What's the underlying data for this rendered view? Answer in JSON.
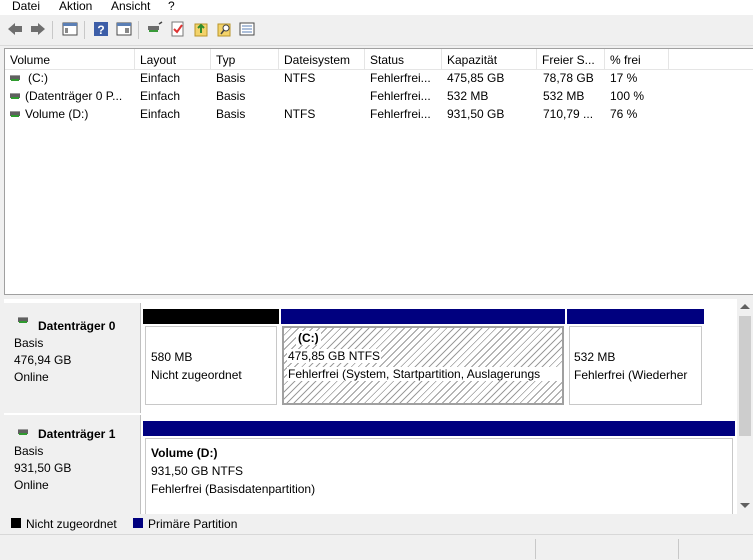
{
  "menu": [
    "Datei",
    "Aktion",
    "Ansicht",
    "?"
  ],
  "toolbar": {
    "buttons": [
      "back-icon",
      "forward-icon",
      "console-tree-icon",
      "help-icon",
      "properties-pane-icon",
      "connect-icon",
      "check-icon",
      "export-icon",
      "search-icon",
      "list-icon"
    ]
  },
  "volume_table": {
    "columns": [
      "Volume",
      "Layout",
      "Typ",
      "Dateisystem",
      "Status",
      "Kapazität",
      "Freier S...",
      "% frei"
    ],
    "rows": [
      {
        "volume": "(C:)",
        "layout": "Einfach",
        "typ": "Basis",
        "dateisystem": "NTFS",
        "status": "Fehlerfrei...",
        "kapazitaet": "475,85 GB",
        "frei": "78,78 GB",
        "prozent": "17 %"
      },
      {
        "volume": "(Datenträger 0 P...",
        "layout": "Einfach",
        "typ": "Basis",
        "dateisystem": "",
        "status": "Fehlerfrei...",
        "kapazitaet": "532 MB",
        "frei": "532 MB",
        "prozent": "100 %"
      },
      {
        "volume": "Volume (D:)",
        "layout": "Einfach",
        "typ": "Basis",
        "dateisystem": "NTFS",
        "status": "Fehlerfrei...",
        "kapazitaet": "931,50 GB",
        "frei": "710,79 ...",
        "prozent": "76 %"
      }
    ]
  },
  "disks": [
    {
      "name": "Datenträger 0",
      "type": "Basis",
      "size": "476,94 GB",
      "state": "Online",
      "partitions": [
        {
          "title": "",
          "size": "580 MB",
          "status": "Nicht zugeordnet",
          "color": "#000000"
        },
        {
          "title": "(C:)",
          "size": "475,85 GB NTFS",
          "status": "Fehlerfrei (System, Startpartition, Auslagerungs",
          "color": "#00007f"
        },
        {
          "title": "",
          "size": "532 MB",
          "status": "Fehlerfrei (Wiederher",
          "color": "#00007f"
        }
      ]
    },
    {
      "name": "Datenträger 1",
      "type": "Basis",
      "size": "931,50 GB",
      "state": "Online",
      "partitions": [
        {
          "title": "Volume  (D:)",
          "size": "931,50 GB NTFS",
          "status": "Fehlerfrei (Basisdatenpartition)",
          "color": "#00007f"
        }
      ]
    }
  ],
  "legend": [
    {
      "label": "Nicht zugeordnet",
      "color": "#000000"
    },
    {
      "label": "Primäre Partition",
      "color": "#00007f"
    }
  ]
}
